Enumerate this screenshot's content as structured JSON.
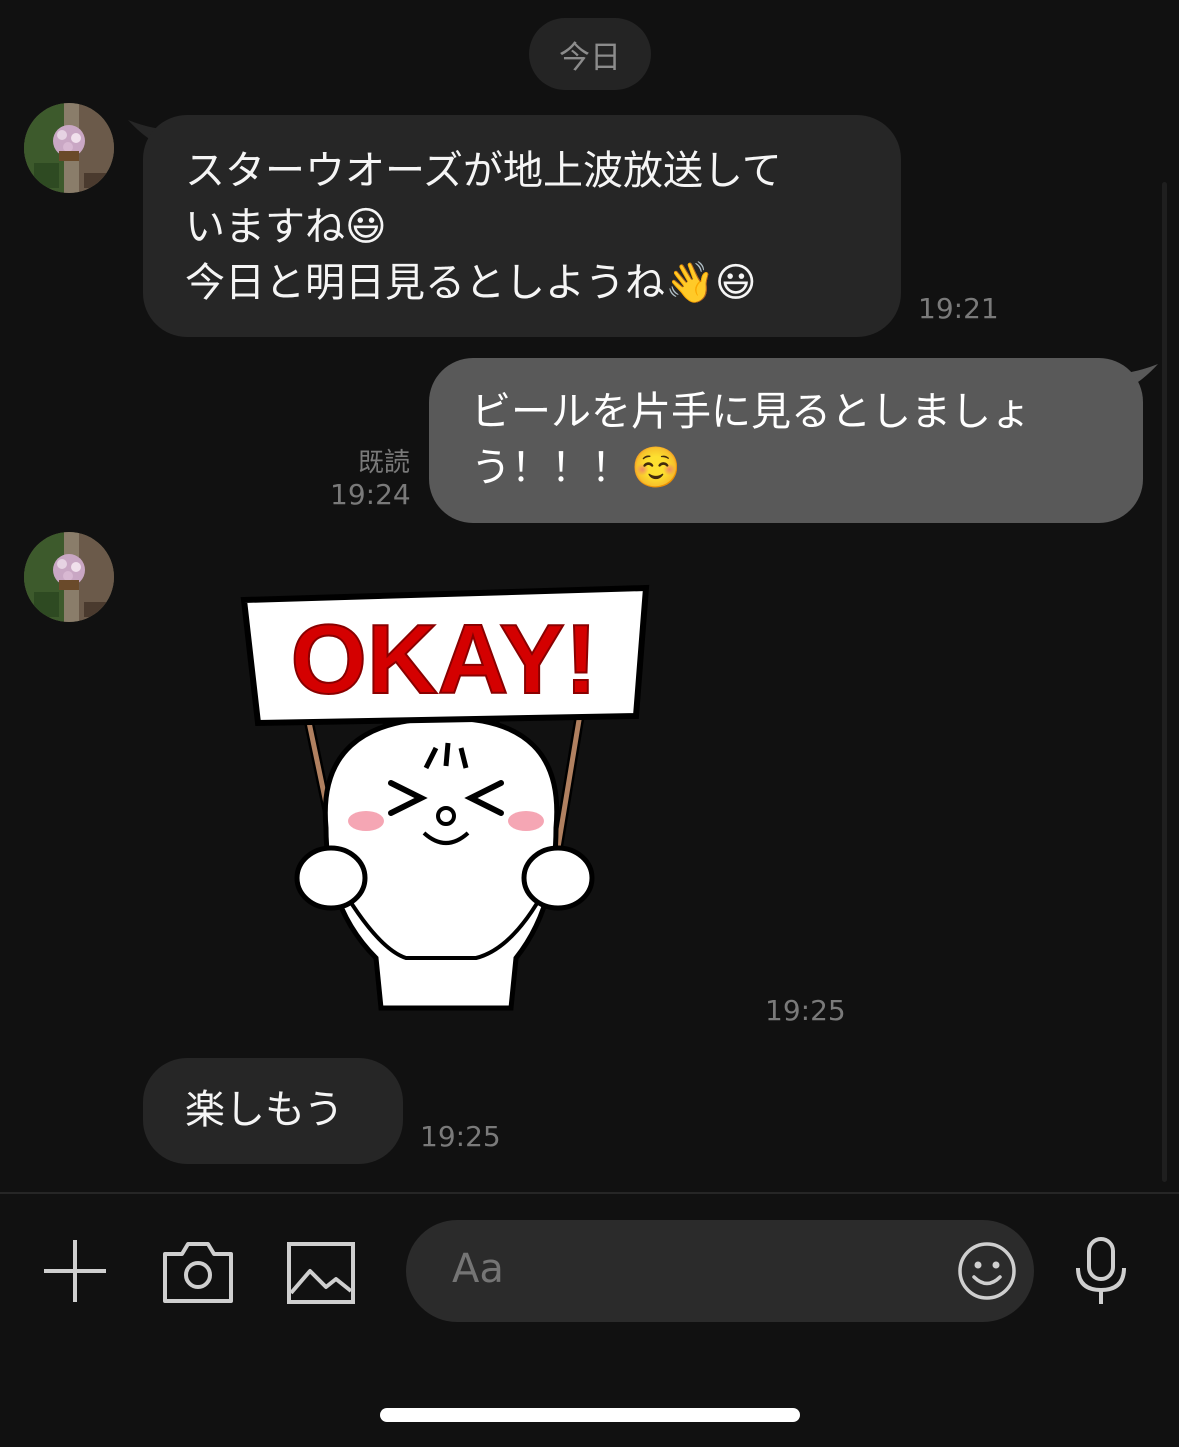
{
  "date_separator": "今日",
  "messages": [
    {
      "sender": "other",
      "lines": [
        "スターウオーズが地上波放送して",
        "いますね",
        "今日と明日見るとしようね"
      ],
      "emojis": [
        "😃",
        "👋",
        "😃"
      ],
      "time": "19:21"
    },
    {
      "sender": "self",
      "lines": [
        "ビールを片手に見るとしましょ",
        "う！！！"
      ],
      "emoji": "☺️",
      "read_label": "既読",
      "time": "19:24"
    },
    {
      "sender": "other",
      "type": "sticker",
      "sticker_text": "OKAY!",
      "time": "19:25"
    },
    {
      "sender": "other",
      "text": "楽しもう",
      "time": "19:25"
    }
  ],
  "input": {
    "placeholder": "Aa"
  },
  "icons": {
    "add": "plus-icon",
    "camera": "camera-icon",
    "gallery": "image-icon",
    "emoji": "smiley-icon",
    "mic": "microphone-icon"
  },
  "colors": {
    "background": "#111111",
    "incoming_bubble": "#262626",
    "outgoing_bubble": "#595959",
    "sticker_red": "#d40000"
  }
}
